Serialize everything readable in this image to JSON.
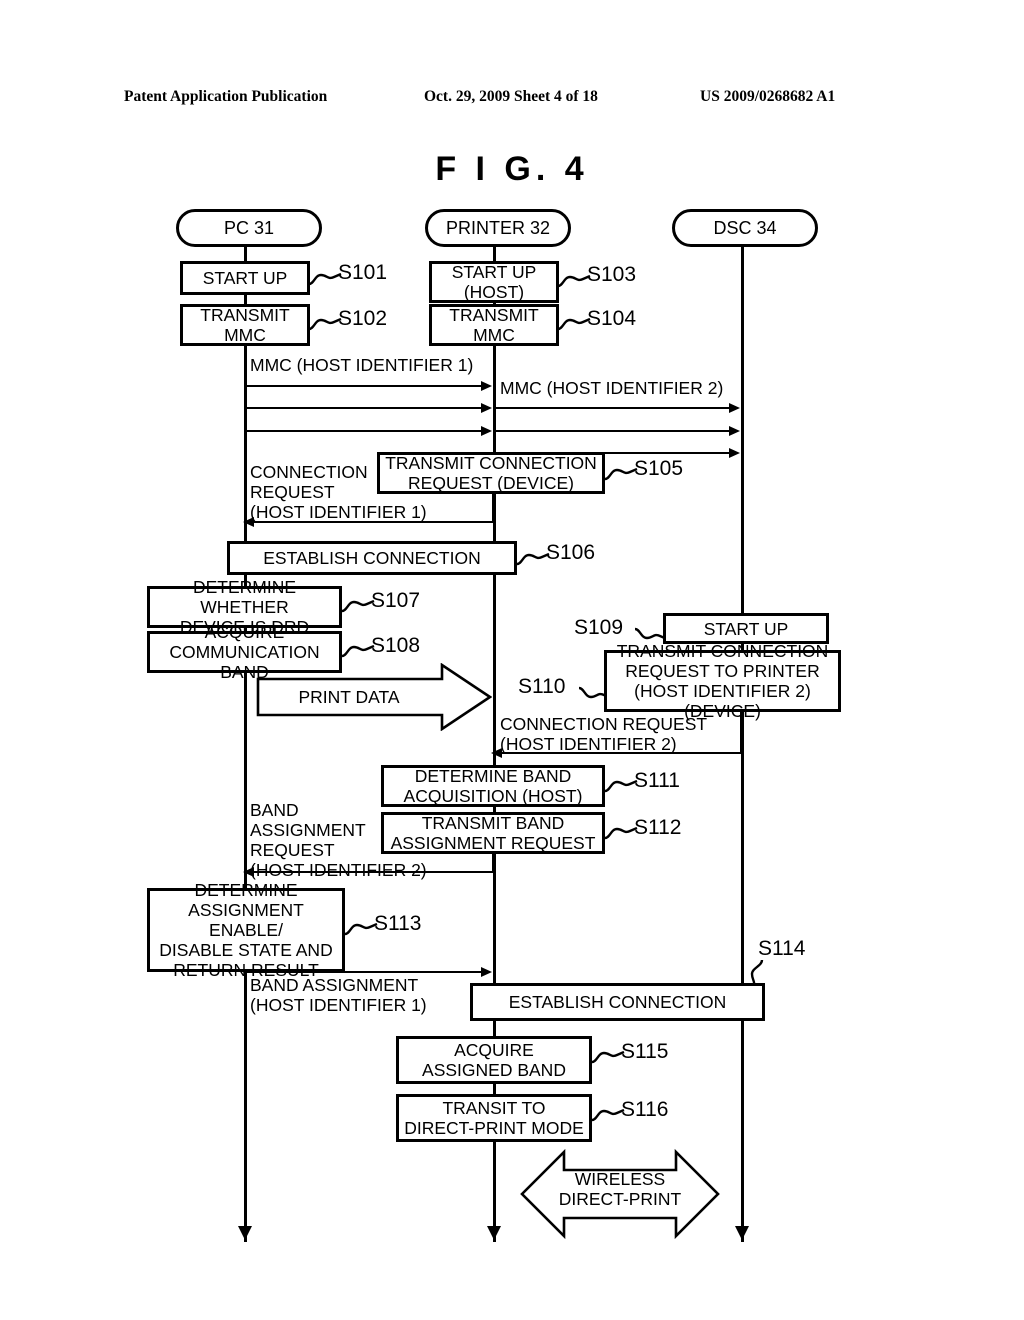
{
  "header": {
    "publication": "Patent Application Publication",
    "date_sheet": "Oct. 29, 2009  Sheet 4 of 18",
    "patent_number": "US 2009/0268682 A1"
  },
  "figure": {
    "title": "F I G.   4"
  },
  "actors": [
    {
      "id": "pc",
      "label": "PC  31"
    },
    {
      "id": "printer",
      "label": "PRINTER 32"
    },
    {
      "id": "dsc",
      "label": "DSC  34"
    }
  ],
  "steps": [
    {
      "id": "S101",
      "label": "S101",
      "text": "START UP"
    },
    {
      "id": "S102",
      "label": "S102",
      "text": "TRANSMIT\nMMC"
    },
    {
      "id": "S103",
      "label": "S103",
      "text": "START UP\n(HOST)"
    },
    {
      "id": "S104",
      "label": "S104",
      "text": "TRANSMIT\nMMC"
    },
    {
      "id": "S105",
      "label": "S105",
      "text": "TRANSMIT CONNECTION\nREQUEST (DEVICE)"
    },
    {
      "id": "S106",
      "label": "S106",
      "text": "ESTABLISH CONNECTION"
    },
    {
      "id": "S107",
      "label": "S107",
      "text": "DETERMINE WHETHER\nDEVICE IS DRD"
    },
    {
      "id": "S108",
      "label": "S108",
      "text": "ACQUIRE\nCOMMUNICATION BAND"
    },
    {
      "id": "S109",
      "label": "S109",
      "text": "START UP"
    },
    {
      "id": "S110",
      "label": "S110",
      "text": "TRANSMIT CONNECTION\nREQUEST TO PRINTER\n(HOST IDENTIFIER 2) (DEVICE)"
    },
    {
      "id": "S111",
      "label": "S111",
      "text": "DETERMINE BAND\nACQUISITION (HOST)"
    },
    {
      "id": "S112",
      "label": "S112",
      "text": "TRANSMIT BAND\nASSIGNMENT REQUEST"
    },
    {
      "id": "S113",
      "label": "S113",
      "text": "DETERMINE\nASSIGNMENT ENABLE/\nDISABLE STATE AND\nRETURN RESULT"
    },
    {
      "id": "S114",
      "label": "S114",
      "text": "ESTABLISH CONNECTION"
    },
    {
      "id": "S115",
      "label": "S115",
      "text": "ACQUIRE\nASSIGNED BAND"
    },
    {
      "id": "S116",
      "label": "S116",
      "text": "TRANSIT TO\nDIRECT-PRINT MODE"
    }
  ],
  "messages": [
    {
      "id": "mmc1",
      "text": "MMC (HOST IDENTIFIER 1)",
      "direction": "right",
      "from": "pc",
      "to": "printer"
    },
    {
      "id": "mmc2",
      "text": "MMC (HOST IDENTIFIER 2)",
      "direction": "right",
      "from": "printer",
      "to": "dsc"
    },
    {
      "id": "conn1",
      "text": "CONNECTION\nREQUEST\n(HOST IDENTIFIER 1)",
      "direction": "left",
      "from": "printer",
      "to": "pc"
    },
    {
      "id": "conn2",
      "text": "CONNECTION REQUEST\n(HOST IDENTIFIER 2)",
      "direction": "left",
      "from": "dsc",
      "to": "printer"
    },
    {
      "id": "bandreq",
      "text": "BAND\nASSIGNMENT\nREQUEST\n(HOST IDENTIFIER 2)",
      "direction": "left",
      "from": "printer",
      "to": "pc"
    },
    {
      "id": "bandasg",
      "text": "BAND ASSIGNMENT\n(HOST IDENTIFIER 1)",
      "direction": "right",
      "from": "pc",
      "to": "printer"
    }
  ],
  "block_arrows": [
    {
      "id": "print-data",
      "text": "PRINT DATA",
      "direction": "right"
    },
    {
      "id": "wireless-print",
      "text": "WIRELESS\nDIRECT-PRINT",
      "direction": "both"
    }
  ],
  "colors": {
    "ink": "#000000",
    "paper": "#ffffff"
  }
}
